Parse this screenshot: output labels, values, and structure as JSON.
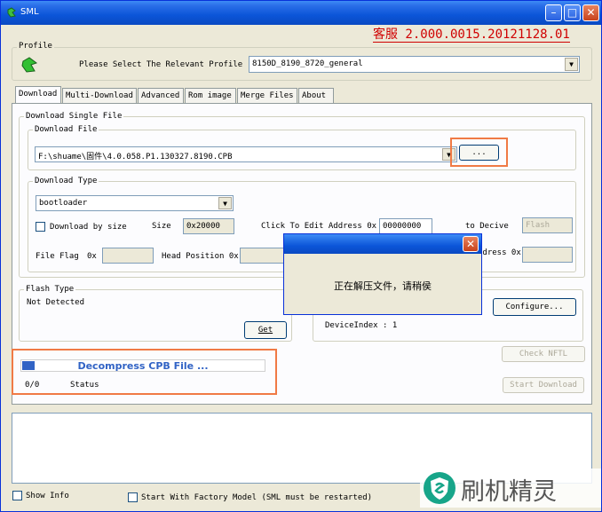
{
  "window": {
    "title": "SML"
  },
  "header": {
    "version": "客服 2.000.0015.20121128.01"
  },
  "profile": {
    "group_label": "Profile",
    "prompt": "Please Select The Relevant Profile",
    "value": "8150D_8190_8720_general"
  },
  "tabs": [
    "Download",
    "Multi-Download",
    "Advanced",
    "Rom image",
    "Merge Files",
    "About"
  ],
  "download_single": {
    "group_label": "Download Single File",
    "file_group_label": "Download File",
    "file_path": "F:\\shuame\\固件\\4.0.058.P1.130327.8190.CPB",
    "browse_label": "..."
  },
  "download_type": {
    "group_label": "Download Type",
    "value": "bootloader",
    "by_size_label": "Download by size",
    "size_label": "Size",
    "size_value": "0x20000",
    "edit_address_label": "Click To Edit Address 0x",
    "edit_address_value": "00000000",
    "to_device_label": "to Decive",
    "to_device_value": "Flash",
    "file_flag_label": "File Flag",
    "file_flag_0x": "0x",
    "head_position_label": "Head Position 0x",
    "address_label": "ddress 0x"
  },
  "flash_type": {
    "group_label": "Flash Type",
    "status": "Not Detected",
    "get_label": "Get"
  },
  "device": {
    "configure_label": "Configure...",
    "device_index": "DeviceIndex : 1"
  },
  "progress": {
    "text": "Decompress CPB File ...",
    "percent": 5,
    "count": "0/0",
    "status": "Status"
  },
  "actions": {
    "check_nftl": "Check NFTL",
    "start_download": "Start Download"
  },
  "footer": {
    "show_info": "Show Info",
    "factory_model": "Start With Factory Model (SML must be restarted)"
  },
  "dialog": {
    "message": "正在解压文件，请稍侯"
  },
  "watermark": {
    "text": "刷机精灵"
  },
  "colors": {
    "accent_red": "#d00000",
    "progress_blue": "#3163c5",
    "highlight_orange": "#f07a45"
  }
}
